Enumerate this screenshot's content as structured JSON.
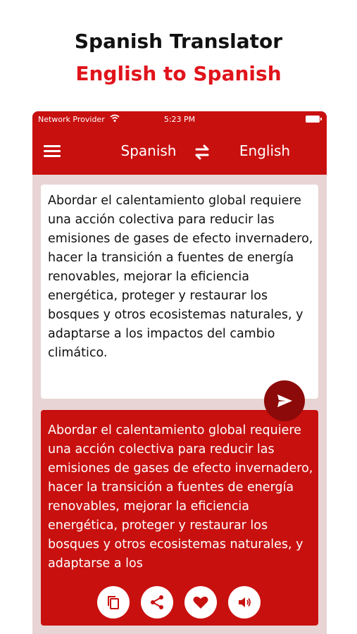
{
  "promo": {
    "title": "Spanish Translator",
    "subtitle": "English to Spanish"
  },
  "status_bar": {
    "provider": "Network Provider",
    "time": "5:23 PM"
  },
  "toolbar": {
    "source_language": "Spanish",
    "target_language": "English"
  },
  "input": {
    "text": "Abordar el calentamiento global requiere una acción colectiva para reducir las emisiones de gases de efecto invernadero, hacer la transición a fuentes de energía renovables, mejorar la eficiencia energética, proteger y restaurar los bosques y otros ecosistemas naturales, y adaptarse a los impactos del cambio climático."
  },
  "output": {
    "text": "Abordar el calentamiento global requiere una acción colectiva para reducir las emisiones de gases de efecto invernadero, hacer la transición a fuentes de energía renovables, mejorar la eficiencia energética, proteger y restaurar los bosques y otros ecosistemas naturales, y adaptarse a los"
  },
  "icons": {
    "menu": "menu-icon",
    "swap": "swap-icon",
    "clear": "close-icon",
    "mic": "mic-off-icon",
    "speak": "volume-icon",
    "send": "send-icon",
    "copy": "copy-icon",
    "share": "share-icon",
    "favorite": "heart-icon"
  },
  "colors": {
    "accent": "#c8100f",
    "send_button": "#8c0a09",
    "subtitle": "#e0141b",
    "background": "#e8d4d4"
  }
}
